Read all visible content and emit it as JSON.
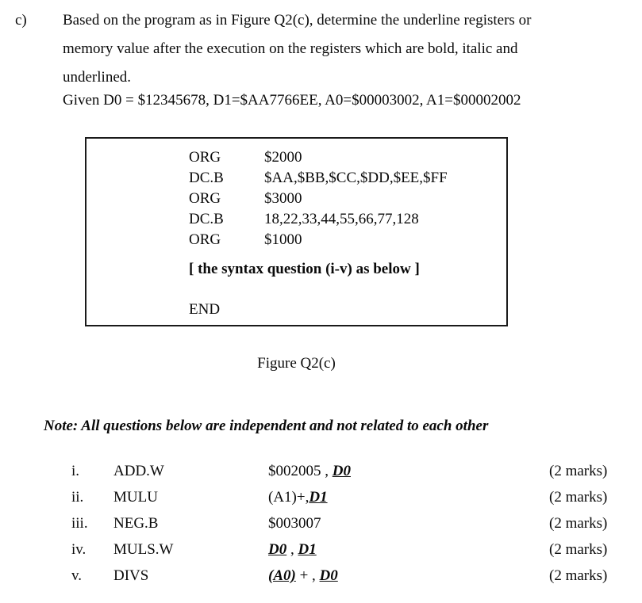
{
  "question": {
    "part_label": "c)",
    "intro_lines": [
      "Based on the program as in Figure Q2(c), determine the underline registers or",
      "memory value after the execution on the registers which are bold, italic and",
      "underlined."
    ],
    "given_line": "Given D0 = $12345678, D1=$AA7766EE, A0=$00003002, A1=$00002002"
  },
  "figure": {
    "caption": "Figure Q2(c)",
    "code_rows": [
      {
        "mnemonic": "ORG",
        "operand": "$2000"
      },
      {
        "mnemonic": "DC.B",
        "operand": "$AA,$BB,$CC,$DD,$EE,$FF"
      },
      {
        "mnemonic": "ORG",
        "operand": "$3000"
      },
      {
        "mnemonic": "DC.B",
        "operand": "18,22,33,44,55,66,77,128"
      },
      {
        "mnemonic": "ORG",
        "operand": "$1000"
      }
    ],
    "syntax_note": "[ the syntax question (i-v) as below ]",
    "end_directive": "END"
  },
  "note": {
    "text": "Note: All questions below are independent and not related to each other"
  },
  "subquestions": [
    {
      "numeral": "i.",
      "mnemonic": "ADD.W",
      "operand_plain_before": "$002005 , ",
      "operand_register": "D0",
      "operand_plain_after": "",
      "marks": "(2 marks)"
    },
    {
      "numeral": "ii.",
      "mnemonic": "MULU",
      "operand_plain_before": "(A1)+,",
      "operand_register": "D1",
      "operand_plain_after": "",
      "marks": "(2 marks)"
    },
    {
      "numeral": "iii.",
      "mnemonic": "NEG.B",
      "operand_plain_before": "$003007",
      "operand_register": "",
      "operand_plain_after": "",
      "marks": "(2 marks)"
    },
    {
      "numeral": "iv.",
      "mnemonic": "MULS.W",
      "operand_plain_before": "",
      "operand_register": "D0",
      "operand_plain_middle": " , ",
      "operand_register2": "D1",
      "operand_plain_after": "",
      "marks": "(2 marks)"
    },
    {
      "numeral": "v.",
      "mnemonic": "DIVS",
      "operand_plain_before": "",
      "operand_register": "(A0)",
      "operand_plain_middle": " + , ",
      "operand_register2": "D0",
      "operand_plain_after": "",
      "marks": "(2 marks)"
    }
  ],
  "colors": {
    "text": "#0a0a0a",
    "page_background": "#ffffff",
    "box_border": "#1a1a1a"
  }
}
